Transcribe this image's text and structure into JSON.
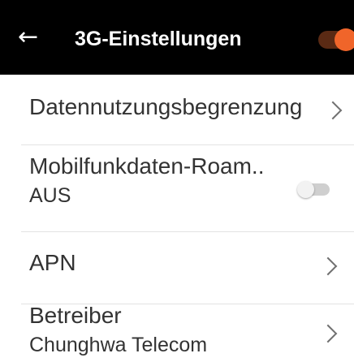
{
  "header": {
    "back_icon": "←",
    "title": "3G-Einstellungen",
    "master_toggle_on": true,
    "accent_color": "#f0652a"
  },
  "rows": [
    {
      "label": "Datennutzungsbegrenzung",
      "trailing": "chevron-right-icon"
    },
    {
      "label": "Mobilfunkdaten-Roam..",
      "sub": "AUS",
      "trailing": "toggle",
      "toggle_on": false
    },
    {
      "label": "APN",
      "trailing": "chevron-right-icon"
    },
    {
      "label": "Betreiber",
      "sub": "Chunghwa Telecom",
      "trailing": "chevron-right-icon"
    }
  ]
}
